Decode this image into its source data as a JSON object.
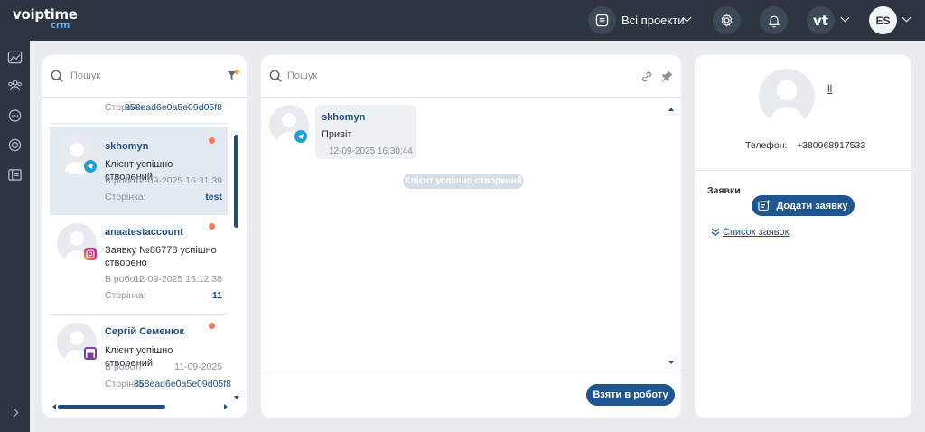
{
  "app": {
    "logo_main": "voiptime",
    "logo_sub": "crm"
  },
  "header": {
    "projects_label": "Всі проекти",
    "account_initials": "vt",
    "user_initials": "ES"
  },
  "sidebar": {
    "items": [
      "dashboard-icon",
      "users-icon",
      "chat-icon",
      "support-icon",
      "tickets-icon"
    ],
    "expand": "chevron-right-icon"
  },
  "list": {
    "search_placeholder": "Пошук",
    "partial_top": {
      "page_label": "Сторінка:",
      "page_value": "858ead6e0a5e09d05f8"
    },
    "conversations": [
      {
        "name": "skhomyn",
        "channel": "telegram",
        "message": "Клієнт успішно створений",
        "status": "В роботі",
        "date": "12-09-2025 16:31:39",
        "page_label": "Сторінка:",
        "page_value": "test",
        "unread": true,
        "selected": true
      },
      {
        "name": "anaatestaccount",
        "channel": "instagram",
        "message": "Заявку №86778 успішно створено",
        "status": "В роботі",
        "date": "12-09-2025 15:12:38",
        "page_label": "Сторінка:",
        "page_value": "11",
        "unread": true,
        "selected": false
      },
      {
        "name": "Сергій Семенюк",
        "channel": "viber",
        "message": "Клієнт успішно створений",
        "status": "В роботі",
        "date": "11-09-2025",
        "page_label": "Сторінка:",
        "page_value": "858ead6e0a5e09d05f8",
        "unread": true,
        "selected": false
      }
    ]
  },
  "chat": {
    "search_placeholder": "Пошук",
    "message": {
      "sender": "skhomyn",
      "text": "Привіт",
      "time": "12-09-2025 16:30:44"
    },
    "system_message": "Клієнт успішно створений",
    "take_button": "Взяти в роботу"
  },
  "contact": {
    "name_marker": "ll",
    "phone_label": "Телефон:",
    "phone_value": "+380968917533",
    "requests_label": "Заявки",
    "add_request_button": "Додати заявку",
    "request_list_link": "Список заявок"
  },
  "colors": {
    "topbar": "#2c3540",
    "accent": "#1f5590",
    "unread_dot": "#f27c55",
    "link": "#1f4f82"
  }
}
